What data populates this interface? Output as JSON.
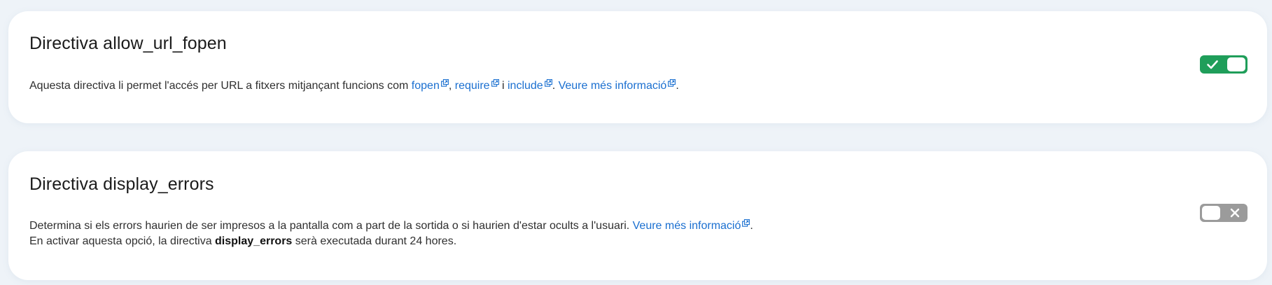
{
  "settings": [
    {
      "title": "Directiva allow_url_fopen",
      "desc_prefix": "Aquesta directiva li permet l'accés per URL a fitxers mitjançant funcions com ",
      "link_fopen": "fopen",
      "sep_comma": ", ",
      "link_require": "require",
      "sep_i": " i ",
      "link_include": "include",
      "sep_period": ". ",
      "link_more": "Veure més informació",
      "end_period": ".",
      "toggle_state": "on",
      "toggle_icon": "check-icon"
    },
    {
      "title": "Directiva display_errors",
      "desc_prefix": "Determina si els errors haurien de ser impresos a la pantalla com a part de la sortida o si haurien d'estar ocults a l'usuari. ",
      "link_more": "Veure més informació",
      "end_period": ".",
      "line2_prefix": "En activar aquesta opció, la directiva ",
      "line2_bold": "display_errors",
      "line2_suffix": " serà executada durant 24 hores.",
      "toggle_state": "off",
      "toggle_icon": "close-icon"
    }
  ],
  "colors": {
    "link": "#1a6fd0",
    "toggle_on": "#1f9e5a",
    "toggle_off": "#9b9b9b",
    "background": "#eef3f8",
    "card": "#ffffff"
  }
}
